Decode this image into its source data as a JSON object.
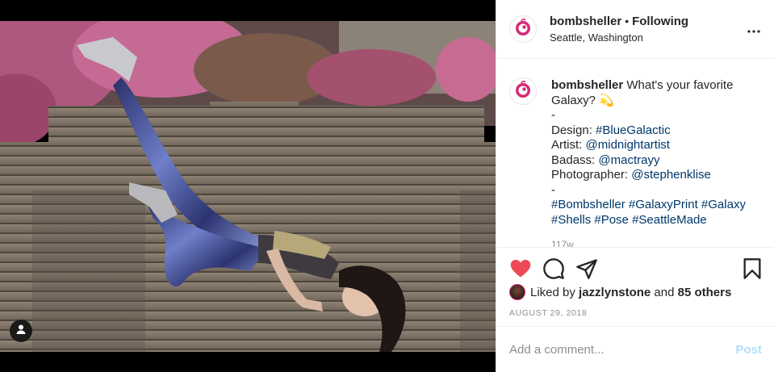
{
  "post": {
    "username": "bombsheller",
    "separator": "•",
    "follow_status": "Following",
    "location": "Seattle, Washington",
    "more_icon": "more-horizontal-icon"
  },
  "caption": {
    "username": "bombsheller",
    "lines": [
      {
        "text": " What's your favorite",
        "tag": ""
      },
      {
        "text": "Galaxy? 💫",
        "tag": ""
      },
      {
        "text": "-",
        "tag": ""
      },
      {
        "text": "Design: ",
        "tag": "#BlueGalactic"
      },
      {
        "text": "Artist: ",
        "tag": "@midnightartist"
      },
      {
        "text": "Badass: ",
        "tag": "@mactrayy"
      },
      {
        "text": "Photographer: ",
        "tag": "@stephenklise"
      },
      {
        "text": "-",
        "tag": ""
      }
    ],
    "hashtags_line1": "#Bombsheller #GalaxyPrint #Galaxy",
    "hashtags_line2": "#Shells #Pose #SeattleMade",
    "faint_time": "117w"
  },
  "actions": {
    "like_icon": "heart-filled-icon",
    "comment_icon": "comment-icon",
    "share_icon": "share-icon",
    "save_icon": "bookmark-icon",
    "like_color": "#ed4956"
  },
  "likes": {
    "prefix": "Liked by ",
    "user": "jazzlynstone",
    "middle": " and ",
    "others": "85 others"
  },
  "date": "AUGUST 29, 2018",
  "comment": {
    "placeholder": "Add a comment...",
    "post_label": "Post"
  },
  "colors": {
    "brand": "#d62976",
    "link": "#00376b",
    "muted": "#8e8e8e",
    "post_disabled": "#b2dffc"
  }
}
